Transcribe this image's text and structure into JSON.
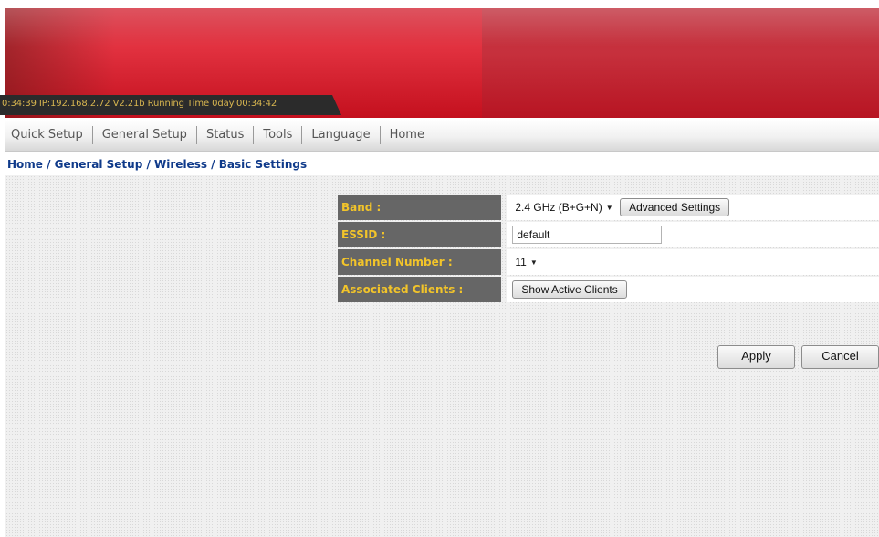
{
  "status_bar": {
    "text": "0:34:39   IP:192.168.2.72   V2.21b   Running Time 0day:00:34:42"
  },
  "nav": {
    "items": [
      "Quick Setup",
      "General Setup",
      "Status",
      "Tools",
      "Language",
      "Home"
    ]
  },
  "breadcrumb": "Home / General Setup / Wireless / Basic Settings",
  "settings": {
    "band_label": "Band :",
    "band_value": "2.4 GHz (B+G+N)",
    "advanced_button": "Advanced Settings",
    "essid_label": "ESSID :",
    "essid_value": "default",
    "channel_label": "Channel Number :",
    "channel_value": "11",
    "clients_label": "Associated Clients :",
    "clients_button": "Show Active Clients"
  },
  "actions": {
    "apply": "Apply",
    "cancel": "Cancel"
  },
  "colors": {
    "banner_red": "#d21a2a",
    "label_bg": "#666666",
    "label_text": "#f2c42a",
    "breadcrumb": "#0f3a8a"
  }
}
